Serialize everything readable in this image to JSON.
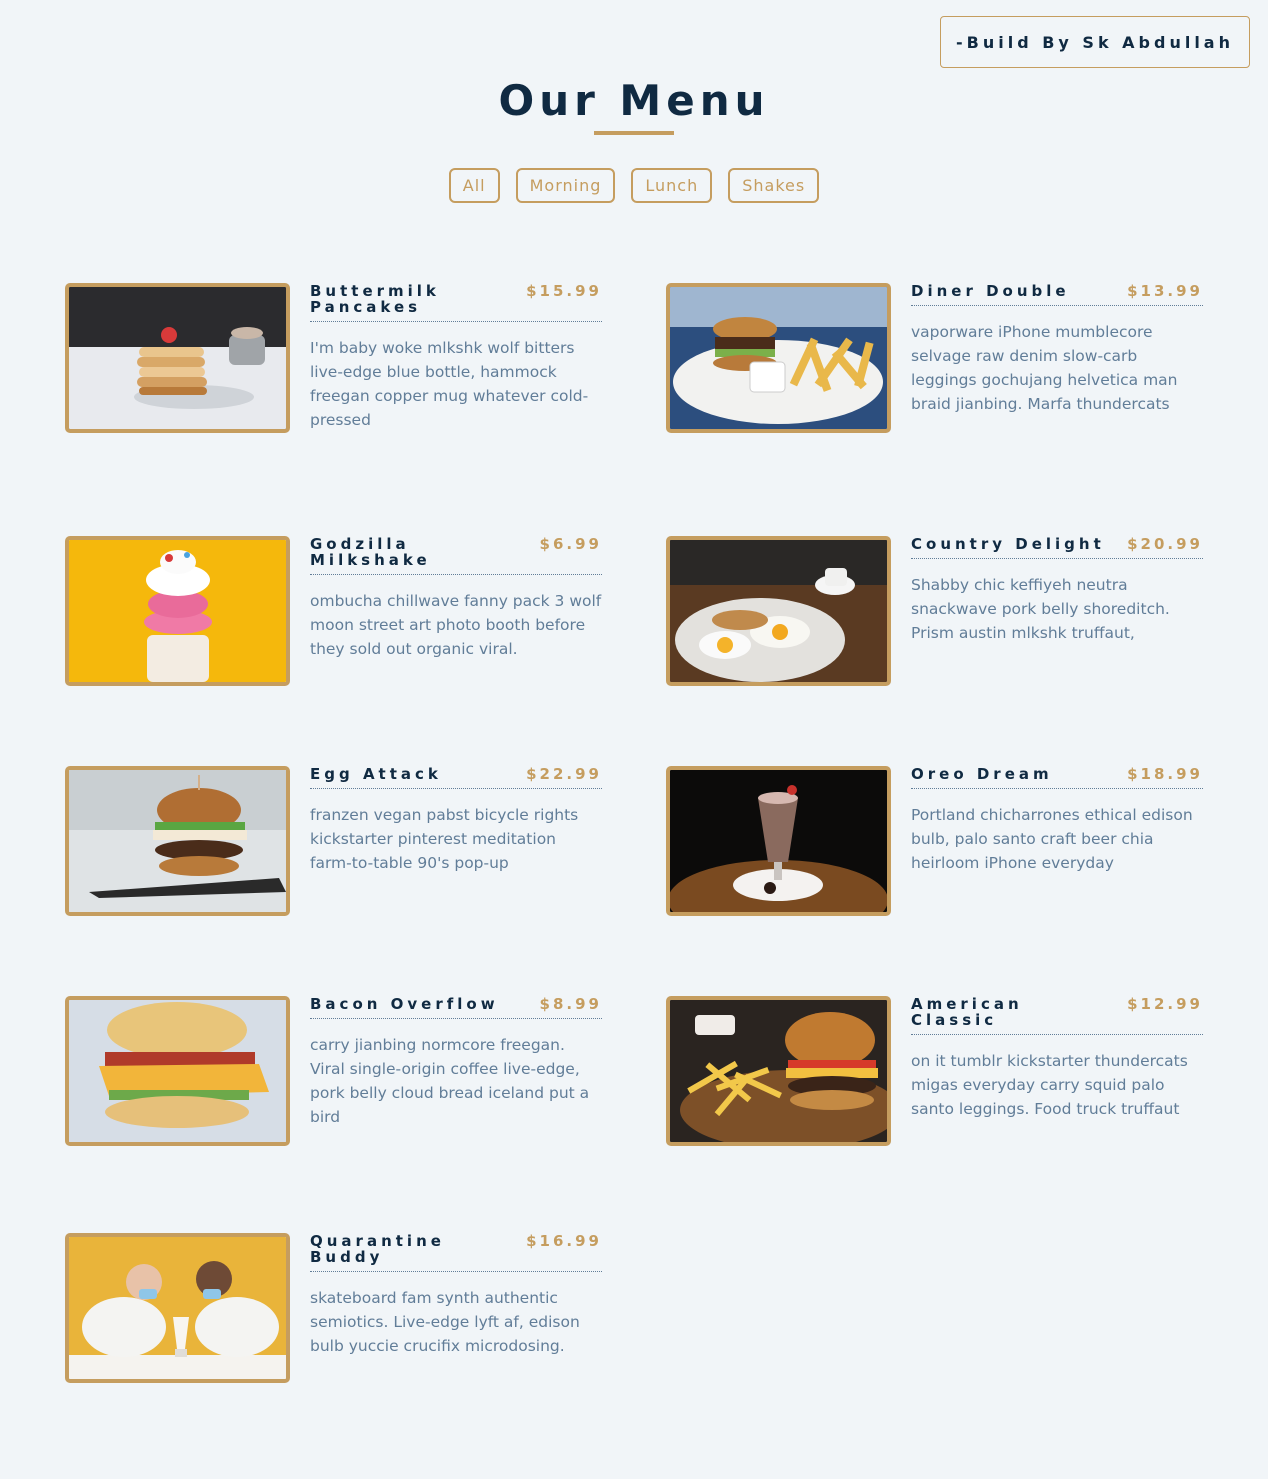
{
  "credit": "-Build By Sk Abdullah",
  "title": "Our Menu",
  "filters": [
    "All",
    "Morning",
    "Lunch",
    "Shakes"
  ],
  "items": [
    {
      "name": "Buttermilk Pancakes",
      "price": "$15.99",
      "desc": "I'm baby woke mlkshk wolf bitters live-edge blue bottle, hammock freegan copper mug whatever cold-pressed",
      "image": "pancakes-photo"
    },
    {
      "name": "Diner Double",
      "price": "$13.99",
      "desc": "vaporware iPhone mumblecore selvage raw denim slow-carb leggings gochujang helvetica man braid jianbing. Marfa thundercats",
      "image": "burger-fries-photo"
    },
    {
      "name": "Godzilla Milkshake",
      "price": "$6.99",
      "desc": "ombucha chillwave fanny pack 3 wolf moon street art photo booth before they sold out organic viral.",
      "image": "milkshake-photo"
    },
    {
      "name": "Country Delight",
      "price": "$20.99",
      "desc": "Shabby chic keffiyeh neutra snackwave pork belly shoreditch. Prism austin mlkshk truffaut,",
      "image": "breakfast-plate-photo"
    },
    {
      "name": "Egg Attack",
      "price": "$22.99",
      "desc": "franzen vegan pabst bicycle rights kickstarter pinterest meditation farm-to-table 90's pop-up",
      "image": "egg-burger-photo"
    },
    {
      "name": "Oreo Dream",
      "price": "$18.99",
      "desc": "Portland chicharrones ethical edison bulb, palo santo craft beer chia heirloom iPhone everyday",
      "image": "oreo-shake-photo"
    },
    {
      "name": "Bacon Overflow",
      "price": "$8.99",
      "desc": "carry jianbing normcore freegan. Viral single-origin coffee live-edge, pork belly cloud bread iceland put a bird",
      "image": "bacon-sandwich-photo"
    },
    {
      "name": "American Classic",
      "price": "$12.99",
      "desc": "on it tumblr kickstarter thundercats migas everyday carry squid palo santo leggings. Food truck truffaut",
      "image": "classic-burger-photo"
    },
    {
      "name": "Quarantine Buddy",
      "price": "$16.99",
      "desc": "skateboard fam synth authentic semiotics. Live-edge lyft af, edison bulb yuccie crucifix microdosing.",
      "image": "couple-shake-photo"
    }
  ],
  "colors": {
    "accent": "#c59d5f",
    "heading": "#102a42",
    "text": "#617d98",
    "background": "#f1f5f8"
  }
}
